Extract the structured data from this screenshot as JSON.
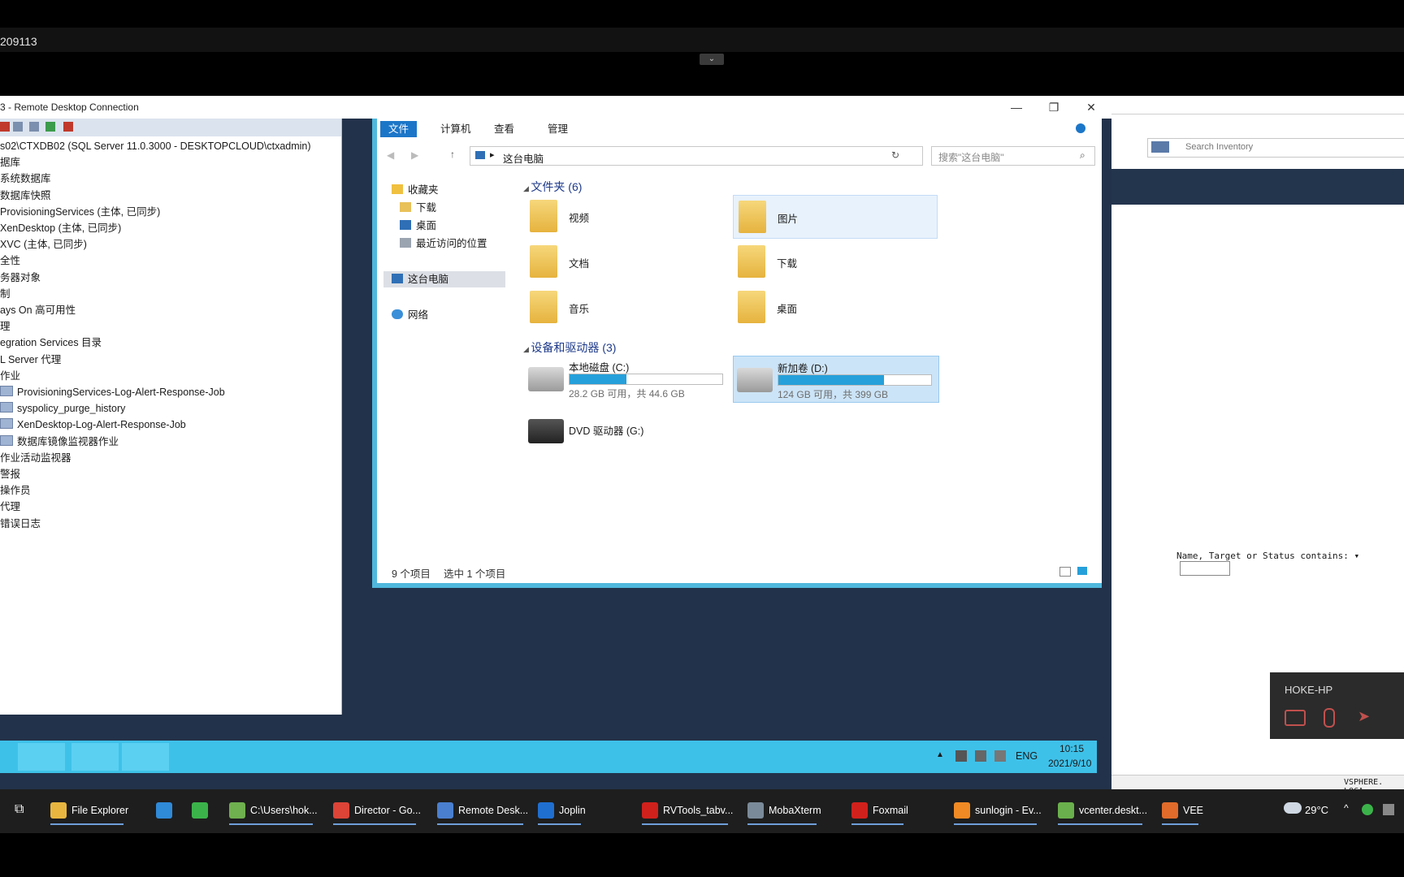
{
  "session": {
    "title": "209113",
    "toggle_icon": "chevron-down"
  },
  "rdp": {
    "title": "3 - Remote Desktop Connection",
    "min": "—",
    "max": "❐",
    "close": "✕"
  },
  "ssms": {
    "tree": [
      "s02\\CTXDB02 (SQL Server 11.0.3000 - DESKTOPCLOUD\\ctxadmin)",
      "据库",
      "系统数据库",
      "数据库快照",
      "ProvisioningServices (主体, 已同步)",
      "XenDesktop (主体, 已同步)",
      "XVC (主体, 已同步)",
      "全性",
      "务器对象",
      "制",
      "ays On 高可用性",
      "理",
      "egration Services 目录",
      "L Server 代理",
      "作业"
    ],
    "jobs": [
      "ProvisioningServices-Log-Alert-Response-Job",
      "syspolicy_purge_history",
      "XenDesktop-Log-Alert-Response-Job",
      "数据库镜像监视器作业"
    ],
    "tree_after": [
      "作业活动监视器",
      "警报",
      "操作员",
      "代理",
      "错误日志"
    ]
  },
  "explorer": {
    "tabs": [
      "文件",
      "计算机",
      "查看",
      "管理"
    ],
    "address": "这台电脑",
    "search_placeholder": "搜索\"这台电脑\"",
    "nav": {
      "favorites": "收藏夹",
      "fav_items": [
        "下载",
        "桌面",
        "最近访问的位置"
      ],
      "this_pc": "这台电脑",
      "network": "网络"
    },
    "folders_header": "文件夹 (6)",
    "folders": [
      "视频",
      "图片",
      "文档",
      "下载",
      "音乐",
      "桌面"
    ],
    "devices_header": "设备和驱动器 (3)",
    "drives": [
      {
        "name": "本地磁盘 (C:)",
        "free": "28.2 GB 可用，共 44.6 GB",
        "used_fraction": 0.37
      },
      {
        "name": "新加卷 (D:)",
        "free": "124 GB 可用，共 399 GB",
        "used_fraction": 0.69
      }
    ],
    "dvd": "DVD 驱动器 (G:)",
    "status_items": "9 个项目",
    "status_selected": "选中 1 个项目"
  },
  "rdp_tray": {
    "lang": "ENG",
    "time": "10:15",
    "date": "2021/9/10"
  },
  "vsphere": {
    "search_placeholder": "Search Inventory",
    "filter_label": "Name, Target or Status contains: ▾",
    "footer": "VSPHERE. LOCA"
  },
  "remote_widget": {
    "host": "HOKE-HP"
  },
  "host_taskbar": {
    "items": [
      {
        "label": "File Explorer",
        "color": "#e8b640"
      },
      {
        "label": "",
        "color": "#2f8ad8"
      },
      {
        "label": "",
        "color": "#3bb34a"
      },
      {
        "label": "C:\\Users\\hok...",
        "color": "#6fb04f"
      },
      {
        "label": "Director - Go...",
        "color": "#db4437"
      },
      {
        "label": "Remote Desk...",
        "color": "#4a7fcf"
      },
      {
        "label": "Joplin",
        "color": "#1f6fd1"
      },
      {
        "label": "RVTools_tabv...",
        "color": "#d0211c"
      },
      {
        "label": "MobaXterm",
        "color": "#7a8a99"
      },
      {
        "label": "Foxmail",
        "color": "#d0211c"
      },
      {
        "label": "sunlogin - Ev...",
        "color": "#f08a24"
      },
      {
        "label": "vcenter.deskt...",
        "color": "#6ab04c"
      },
      {
        "label": "VEE",
        "color": "#e06b2a"
      }
    ],
    "weather": "29°C"
  }
}
